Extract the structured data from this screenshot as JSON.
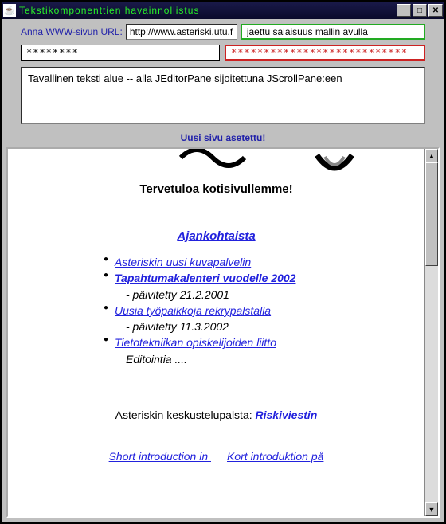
{
  "window": {
    "title": "Tekstikomponenttien  havainnollistus"
  },
  "upper": {
    "url_label": "Anna WWW-sivun URL:",
    "url_value": "http://www.asteriski.utu.fi",
    "formatted_value": "jaettu salaisuus mallin avulla",
    "password_plain": "********",
    "password_red": "***************************",
    "textarea_value": "Tavallinen teksti alue -- alla JEditorPane sijoitettuna JScrollPane:een",
    "status": "Uusi sivu asetettu!"
  },
  "page": {
    "welcome_title": "Tervetuloa kotisivullemme!",
    "section_heading": " Ajankohtaista",
    "news": [
      {
        "link": "Asteriskin uusi kuvapalvelin",
        "bold": false
      },
      {
        "link": "Tapahtumakalenteri vuodelle 2002",
        "bold": true,
        "sub": "- päivitetty 21.2.2001"
      },
      {
        "link": "Uusia työpaikkoja rekrypalstalla",
        "bold": false,
        "sub": "- päivitetty 11.3.2002"
      },
      {
        "link": "Tietotekniikan opiskelijoiden liitto",
        "bold": false,
        "sub": "Editointia ...."
      }
    ],
    "forum_label": "Asteriskin keskustelupalsta: ",
    "forum_link": "Riskiviestin",
    "intro_en": "Short introduction in   ",
    "intro_sv": "Kort introduktion på  "
  }
}
